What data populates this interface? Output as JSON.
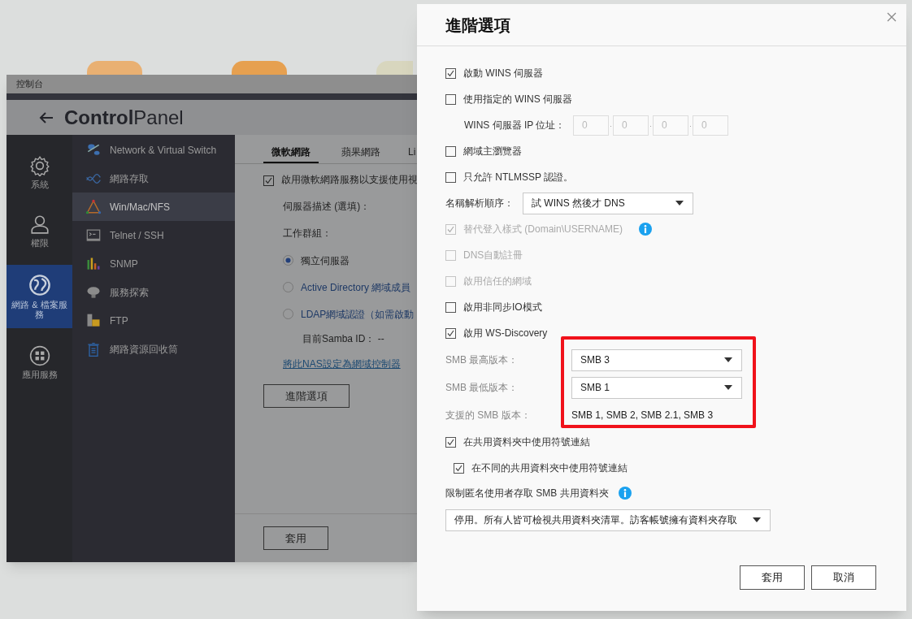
{
  "window": {
    "title": "控制台",
    "header": "**Control**Panel",
    "rail": [
      {
        "label": "系統",
        "selected": false
      },
      {
        "label": "權限",
        "selected": false
      },
      {
        "label": "網路 & 檔案服務",
        "selected": true
      },
      {
        "label": "應用服務",
        "selected": false
      }
    ],
    "menu": [
      {
        "label": "Network & Virtual Switch",
        "selected": false
      },
      {
        "label": "網路存取",
        "selected": false
      },
      {
        "label": "Win/Mac/NFS",
        "selected": true
      },
      {
        "label": "Telnet / SSH",
        "selected": false
      },
      {
        "label": "SNMP",
        "selected": false
      },
      {
        "label": "服務探索",
        "selected": false
      },
      {
        "label": "FTP",
        "selected": false
      },
      {
        "label": "網路資源回收筒",
        "selected": false
      }
    ],
    "tabs": [
      {
        "label": "微軟網路",
        "selected": true
      },
      {
        "label": "蘋果網路",
        "selected": false
      },
      {
        "label": "Li",
        "selected": false
      }
    ],
    "enable_checkbox": {
      "label": "啟用微軟網路服務以支援使用視",
      "checked": true
    },
    "server_description_label": "伺服器描述 (選填)：",
    "workgroup_label": "工作群組：",
    "radios": [
      {
        "label": "獨立伺服器",
        "selected": true
      },
      {
        "label": "Active Directory 網域成員",
        "selected": false
      },
      {
        "label": "LDAP網域認證（如需啟動",
        "selected": false
      }
    ],
    "samba_id": "目前Samba ID： --",
    "link": "將此NAS設定為網域控制器",
    "advanced_button": "進階選項",
    "apply_button": "套用"
  },
  "dialog": {
    "title": "進階選項",
    "items": [
      {
        "kind": "checkbox",
        "label": "啟動 WINS 伺服器",
        "checked": true,
        "disabled": false
      },
      {
        "kind": "checkbox",
        "label": "使用指定的 WINS 伺服器",
        "checked": false,
        "disabled": false
      },
      {
        "kind": "ip",
        "label": "WINS 伺服器 IP 位址：",
        "octets": [
          "0",
          "0",
          "0",
          "0"
        ],
        "separators": [
          ".",
          ".",
          "."
        ]
      },
      {
        "kind": "checkbox",
        "label": "網域主瀏覽器",
        "checked": false,
        "disabled": false
      },
      {
        "kind": "checkbox",
        "label": "只允許 NTLMSSP 認證。",
        "checked": false,
        "disabled": false
      },
      {
        "kind": "select",
        "label": "名稱解析順序：",
        "value": "試 WINS 然後才 DNS"
      },
      {
        "kind": "checkbox",
        "label": "替代登入樣式 (Domain\\USERNAME)",
        "checked": true,
        "disabled": true,
        "info": true
      },
      {
        "kind": "checkbox",
        "label": "DNS自動註冊",
        "checked": false,
        "disabled": true
      },
      {
        "kind": "checkbox",
        "label": "啟用信任的網域",
        "checked": false,
        "disabled": true
      },
      {
        "kind": "checkbox",
        "label": "啟用非同步IO模式",
        "checked": false,
        "disabled": false
      },
      {
        "kind": "checkbox",
        "label": "啟用 WS-Discovery",
        "checked": true,
        "disabled": false
      },
      {
        "kind": "smb_group",
        "highlighted": true,
        "rows": [
          {
            "kind": "select",
            "label": "SMB 最高版本：",
            "value": "SMB 3"
          },
          {
            "kind": "select",
            "label": "SMB 最低版本：",
            "value": "SMB 1"
          },
          {
            "kind": "text",
            "label": "支援的 SMB 版本：",
            "value": "SMB 1, SMB 2, SMB 2.1, SMB 3"
          }
        ]
      },
      {
        "kind": "checkbox",
        "label": "在共用資料夾中使用符號連結",
        "checked": true,
        "disabled": false,
        "children": [
          {
            "kind": "checkbox",
            "label": "在不同的共用資料夾中使用符號連結",
            "checked": true,
            "disabled": false
          }
        ]
      },
      {
        "kind": "heading",
        "label": "限制匿名使用者存取 SMB 共用資料夾",
        "info": true
      },
      {
        "kind": "wide_select",
        "value": "停用。所有人皆可檢視共用資料夾清單。訪客帳號擁有資料夾存取"
      }
    ],
    "buttons": [
      "套用",
      "取消"
    ]
  }
}
